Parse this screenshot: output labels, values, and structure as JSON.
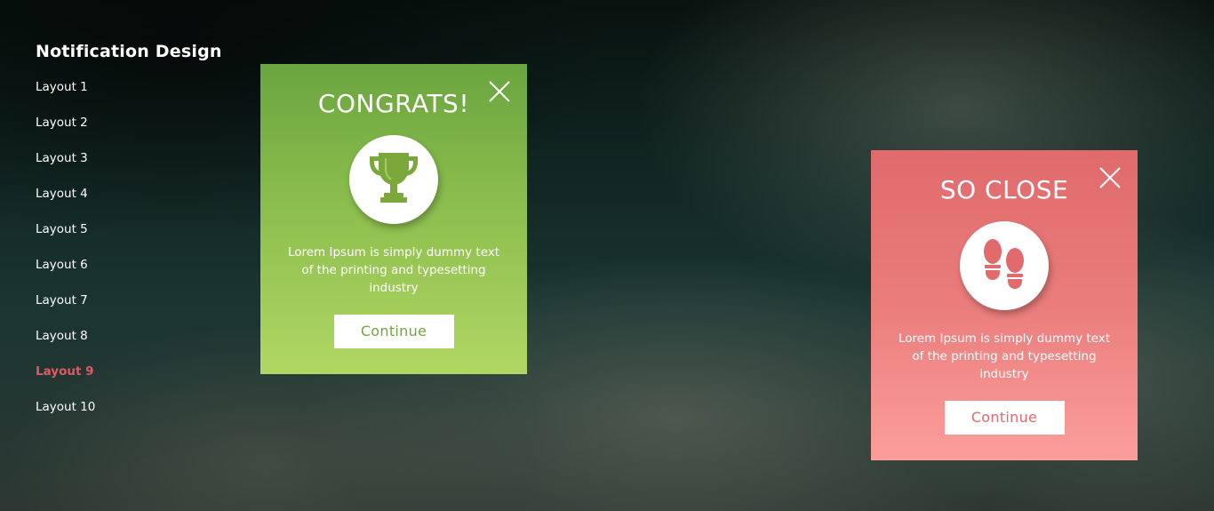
{
  "sidebar": {
    "title": "Notification Design",
    "items": [
      {
        "label": "Layout 1",
        "active": false
      },
      {
        "label": "Layout 2",
        "active": false
      },
      {
        "label": "Layout 3",
        "active": false
      },
      {
        "label": "Layout 4",
        "active": false
      },
      {
        "label": "Layout 5",
        "active": false
      },
      {
        "label": "Layout 6",
        "active": false
      },
      {
        "label": "Layout 7",
        "active": false
      },
      {
        "label": "Layout 8",
        "active": false
      },
      {
        "label": "Layout 9",
        "active": true
      },
      {
        "label": "Layout 10",
        "active": false
      }
    ]
  },
  "cards": {
    "success": {
      "title": "CONGRATS!",
      "icon": "trophy-icon",
      "text": "Lorem Ipsum is simply dummy text of the printing and typesetting industry",
      "button_label": "Continue"
    },
    "failure": {
      "title": "SO CLOSE",
      "icon": "footprints-icon",
      "text": "Lorem Ipsum is simply dummy text of the printing and typesetting industry",
      "button_label": "Continue"
    }
  },
  "colors": {
    "active_item": "#e05a64",
    "success_accent": "#72a63c",
    "failure_accent": "#e06a6c"
  }
}
